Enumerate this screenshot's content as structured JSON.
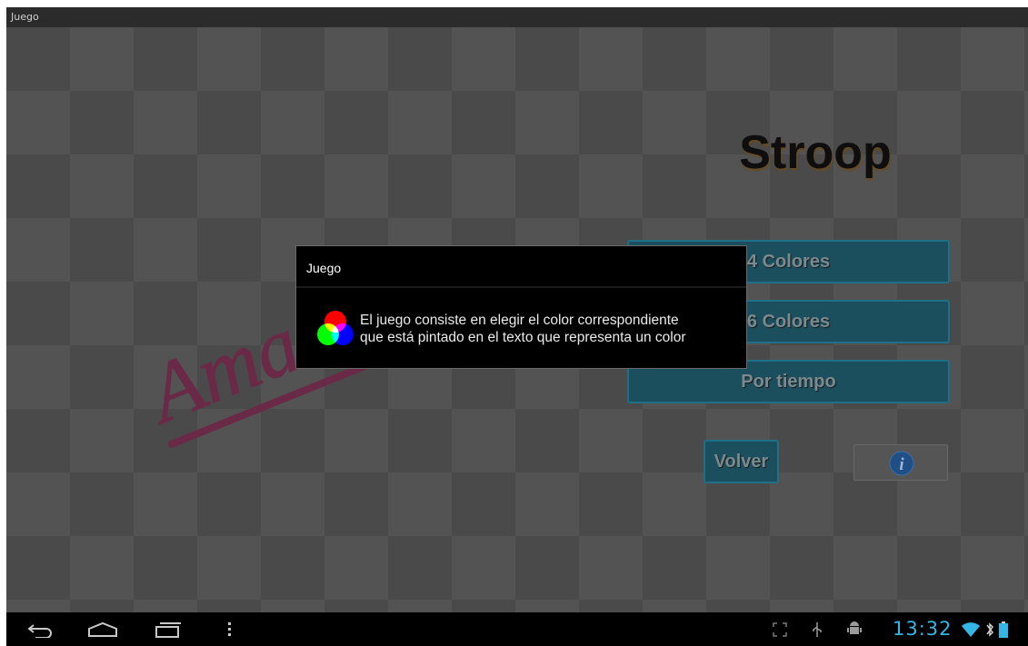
{
  "window": {
    "title": "Juego"
  },
  "app": {
    "title": "Stroop",
    "art_word": "Amarillo",
    "art_color": "#c2185b",
    "buttons": {
      "four_colors": "4 Colores",
      "six_colors": "6 Colores",
      "timed": "Por tiempo",
      "back": "Volver"
    },
    "info_icon": "info-icon",
    "accent_color": "#1f6f86"
  },
  "dialog": {
    "title": "Juego",
    "message_line1": "El juego consiste en elegir el color correspondiente",
    "message_line2": "que está pintado en el texto que representa un color",
    "icon": "rgb-circles-icon"
  },
  "status": {
    "time": "13:32",
    "clock_color": "#33b5e5"
  },
  "navbar": {
    "icons": [
      "back-icon",
      "home-icon",
      "recent-apps-icon",
      "menu-icon"
    ],
    "status_icons": [
      "screen-compat-icon",
      "usb-icon",
      "android-debug-icon",
      "wifi-icon",
      "bluetooth-icon",
      "battery-icon"
    ]
  }
}
